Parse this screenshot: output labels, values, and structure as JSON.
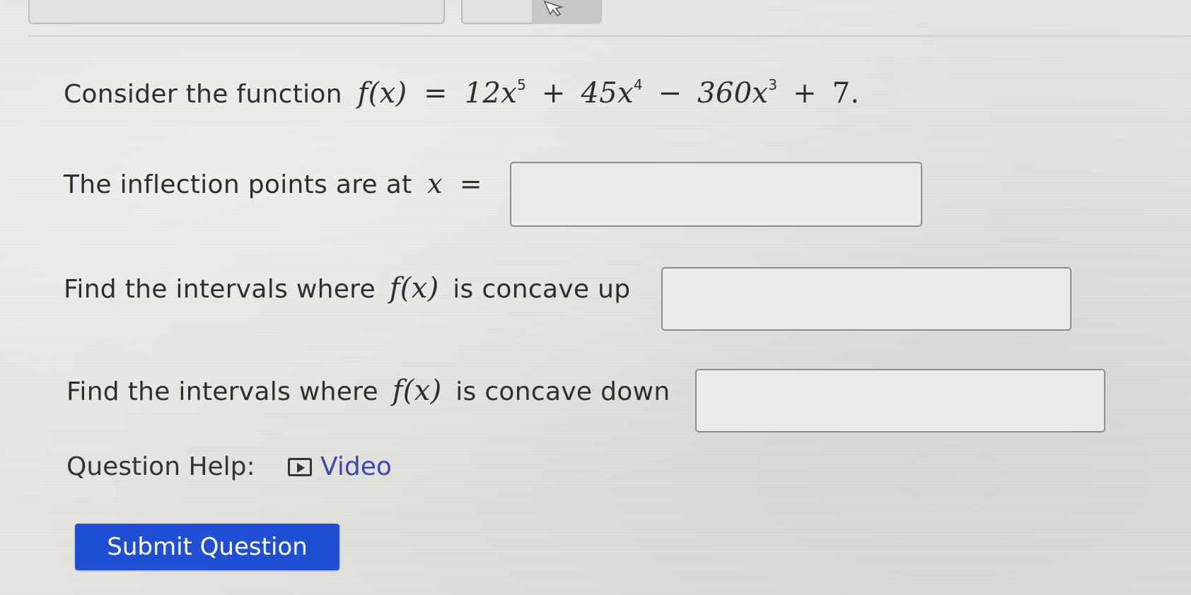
{
  "question": {
    "intro": "Consider the function",
    "function_lhs": "f(x)",
    "eq": "=",
    "term1": "12x",
    "exp1": "5",
    "plus1": "+",
    "term2": "45x",
    "exp2": "4",
    "minus": "−",
    "term3": "360x",
    "exp3": "3",
    "plus2": "+",
    "term4": "7.",
    "inflection_label": "The inflection points are at",
    "inflection_var": "x",
    "inflection_eq": "=",
    "inflection_value": "",
    "concave_up_prefix": "Find the intervals where",
    "concave_up_fx": "f(x)",
    "concave_up_suffix": "is concave up",
    "concave_up_value": "",
    "concave_down_prefix": "Find the intervals where",
    "concave_down_fx": "f(x)",
    "concave_down_suffix": "is concave down",
    "concave_down_value": ""
  },
  "help": {
    "label": "Question Help:",
    "video_label": "Video",
    "video_icon": "play-video-icon"
  },
  "submit_label": "Submit Question",
  "colors": {
    "accent": "#1e4fd4",
    "link": "#3b48a8"
  }
}
